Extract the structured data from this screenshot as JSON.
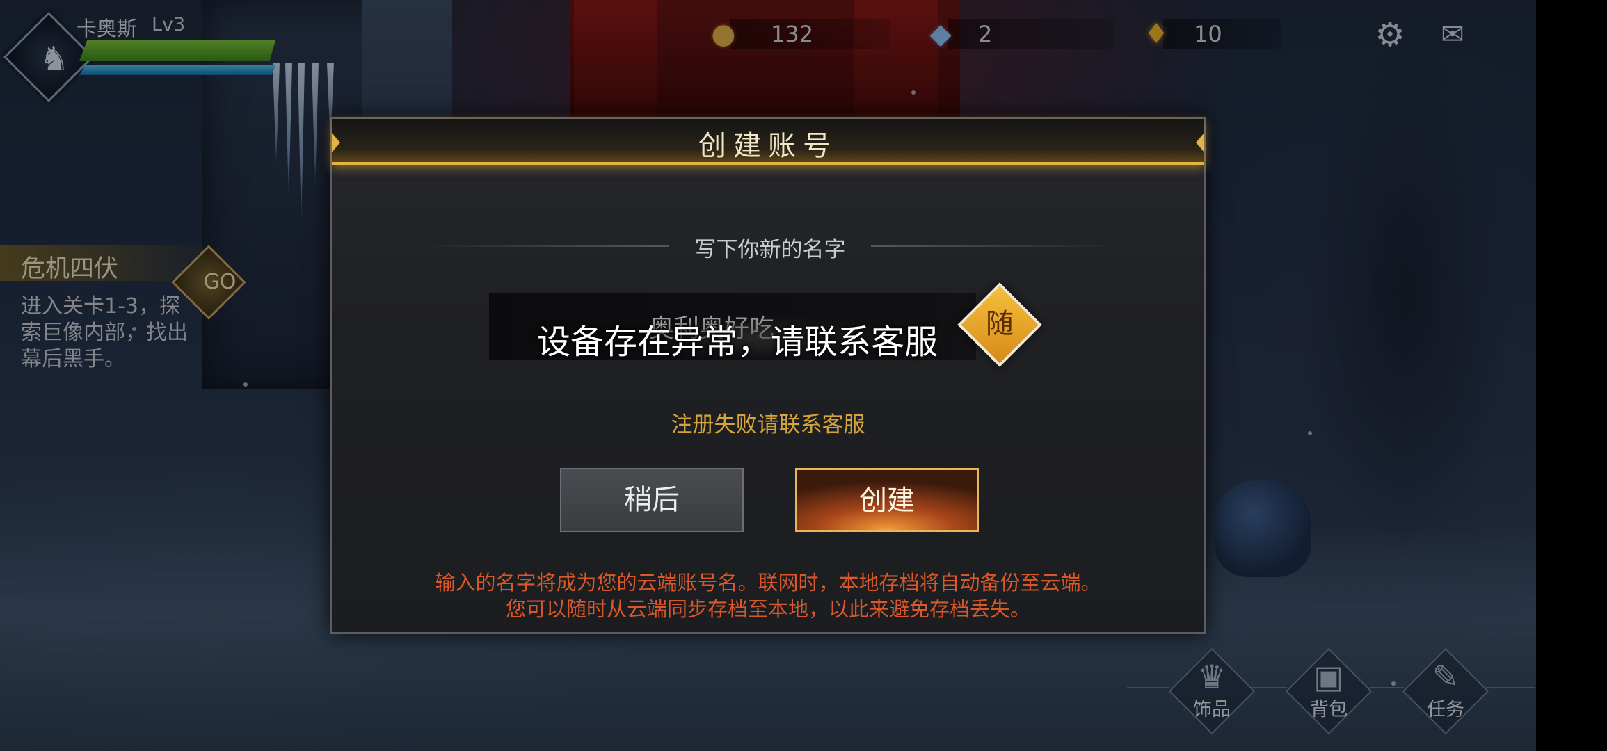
{
  "player": {
    "name": "卡奥斯",
    "level": "Lv3"
  },
  "quest": {
    "title": "危机四伏",
    "go_label": "GO",
    "description": "进入关卡1-3，探索巨像内部，找出幕后黑手。"
  },
  "currencies": {
    "gold": {
      "icon": "gold-coins-icon",
      "value": "132"
    },
    "gem": {
      "icon": "crystal-gem-icon",
      "value": "2"
    },
    "potion": {
      "icon": "potion-flask-icon",
      "value": "10"
    }
  },
  "top_buttons": [
    {
      "icon": "gear-icon"
    },
    {
      "icon": "mail-icon"
    }
  ],
  "dialog": {
    "title": "创建账号",
    "prompt": "写下你新的名字",
    "name_value": "奥利奥好吃",
    "random_label": "随",
    "error": "注册失败请联系客服",
    "later_label": "稍后",
    "create_label": "创建",
    "notice_line1": "输入的名字将成为您的云端账号名。联网时，本地存档将自动备份至云端。",
    "notice_line2": "您可以随时从云端同步存档至本地，以此来避免存档丢失。"
  },
  "toast": {
    "message": "设备存在异常，请联系客服"
  },
  "menu": [
    {
      "label": "饰品",
      "icon": "helmet-icon"
    },
    {
      "label": "背包",
      "icon": "backpack-icon"
    },
    {
      "label": "任务",
      "icon": "scroll-icon"
    }
  ],
  "colors": {
    "accent_gold": "#e2b444",
    "error_orange": "#d5a53b",
    "notice_red": "#d9582b"
  }
}
